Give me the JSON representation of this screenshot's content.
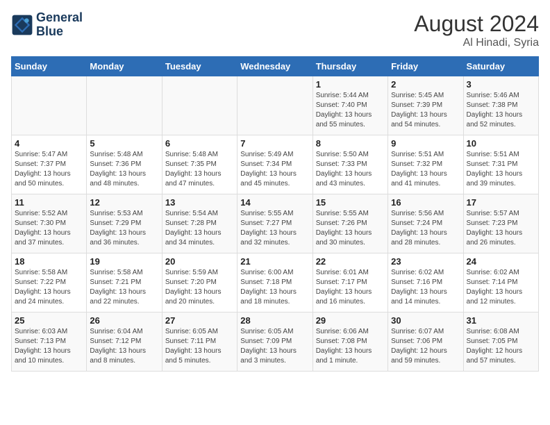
{
  "header": {
    "logo_line1": "General",
    "logo_line2": "Blue",
    "month_year": "August 2024",
    "location": "Al Hinadi, Syria"
  },
  "days_of_week": [
    "Sunday",
    "Monday",
    "Tuesday",
    "Wednesday",
    "Thursday",
    "Friday",
    "Saturday"
  ],
  "weeks": [
    [
      {
        "day": "",
        "info": ""
      },
      {
        "day": "",
        "info": ""
      },
      {
        "day": "",
        "info": ""
      },
      {
        "day": "",
        "info": ""
      },
      {
        "day": "1",
        "info": "Sunrise: 5:44 AM\nSunset: 7:40 PM\nDaylight: 13 hours\nand 55 minutes."
      },
      {
        "day": "2",
        "info": "Sunrise: 5:45 AM\nSunset: 7:39 PM\nDaylight: 13 hours\nand 54 minutes."
      },
      {
        "day": "3",
        "info": "Sunrise: 5:46 AM\nSunset: 7:38 PM\nDaylight: 13 hours\nand 52 minutes."
      }
    ],
    [
      {
        "day": "4",
        "info": "Sunrise: 5:47 AM\nSunset: 7:37 PM\nDaylight: 13 hours\nand 50 minutes."
      },
      {
        "day": "5",
        "info": "Sunrise: 5:48 AM\nSunset: 7:36 PM\nDaylight: 13 hours\nand 48 minutes."
      },
      {
        "day": "6",
        "info": "Sunrise: 5:48 AM\nSunset: 7:35 PM\nDaylight: 13 hours\nand 47 minutes."
      },
      {
        "day": "7",
        "info": "Sunrise: 5:49 AM\nSunset: 7:34 PM\nDaylight: 13 hours\nand 45 minutes."
      },
      {
        "day": "8",
        "info": "Sunrise: 5:50 AM\nSunset: 7:33 PM\nDaylight: 13 hours\nand 43 minutes."
      },
      {
        "day": "9",
        "info": "Sunrise: 5:51 AM\nSunset: 7:32 PM\nDaylight: 13 hours\nand 41 minutes."
      },
      {
        "day": "10",
        "info": "Sunrise: 5:51 AM\nSunset: 7:31 PM\nDaylight: 13 hours\nand 39 minutes."
      }
    ],
    [
      {
        "day": "11",
        "info": "Sunrise: 5:52 AM\nSunset: 7:30 PM\nDaylight: 13 hours\nand 37 minutes."
      },
      {
        "day": "12",
        "info": "Sunrise: 5:53 AM\nSunset: 7:29 PM\nDaylight: 13 hours\nand 36 minutes."
      },
      {
        "day": "13",
        "info": "Sunrise: 5:54 AM\nSunset: 7:28 PM\nDaylight: 13 hours\nand 34 minutes."
      },
      {
        "day": "14",
        "info": "Sunrise: 5:55 AM\nSunset: 7:27 PM\nDaylight: 13 hours\nand 32 minutes."
      },
      {
        "day": "15",
        "info": "Sunrise: 5:55 AM\nSunset: 7:26 PM\nDaylight: 13 hours\nand 30 minutes."
      },
      {
        "day": "16",
        "info": "Sunrise: 5:56 AM\nSunset: 7:24 PM\nDaylight: 13 hours\nand 28 minutes."
      },
      {
        "day": "17",
        "info": "Sunrise: 5:57 AM\nSunset: 7:23 PM\nDaylight: 13 hours\nand 26 minutes."
      }
    ],
    [
      {
        "day": "18",
        "info": "Sunrise: 5:58 AM\nSunset: 7:22 PM\nDaylight: 13 hours\nand 24 minutes."
      },
      {
        "day": "19",
        "info": "Sunrise: 5:58 AM\nSunset: 7:21 PM\nDaylight: 13 hours\nand 22 minutes."
      },
      {
        "day": "20",
        "info": "Sunrise: 5:59 AM\nSunset: 7:20 PM\nDaylight: 13 hours\nand 20 minutes."
      },
      {
        "day": "21",
        "info": "Sunrise: 6:00 AM\nSunset: 7:18 PM\nDaylight: 13 hours\nand 18 minutes."
      },
      {
        "day": "22",
        "info": "Sunrise: 6:01 AM\nSunset: 7:17 PM\nDaylight: 13 hours\nand 16 minutes."
      },
      {
        "day": "23",
        "info": "Sunrise: 6:02 AM\nSunset: 7:16 PM\nDaylight: 13 hours\nand 14 minutes."
      },
      {
        "day": "24",
        "info": "Sunrise: 6:02 AM\nSunset: 7:14 PM\nDaylight: 13 hours\nand 12 minutes."
      }
    ],
    [
      {
        "day": "25",
        "info": "Sunrise: 6:03 AM\nSunset: 7:13 PM\nDaylight: 13 hours\nand 10 minutes."
      },
      {
        "day": "26",
        "info": "Sunrise: 6:04 AM\nSunset: 7:12 PM\nDaylight: 13 hours\nand 8 minutes."
      },
      {
        "day": "27",
        "info": "Sunrise: 6:05 AM\nSunset: 7:11 PM\nDaylight: 13 hours\nand 5 minutes."
      },
      {
        "day": "28",
        "info": "Sunrise: 6:05 AM\nSunset: 7:09 PM\nDaylight: 13 hours\nand 3 minutes."
      },
      {
        "day": "29",
        "info": "Sunrise: 6:06 AM\nSunset: 7:08 PM\nDaylight: 13 hours\nand 1 minute."
      },
      {
        "day": "30",
        "info": "Sunrise: 6:07 AM\nSunset: 7:06 PM\nDaylight: 12 hours\nand 59 minutes."
      },
      {
        "day": "31",
        "info": "Sunrise: 6:08 AM\nSunset: 7:05 PM\nDaylight: 12 hours\nand 57 minutes."
      }
    ]
  ]
}
